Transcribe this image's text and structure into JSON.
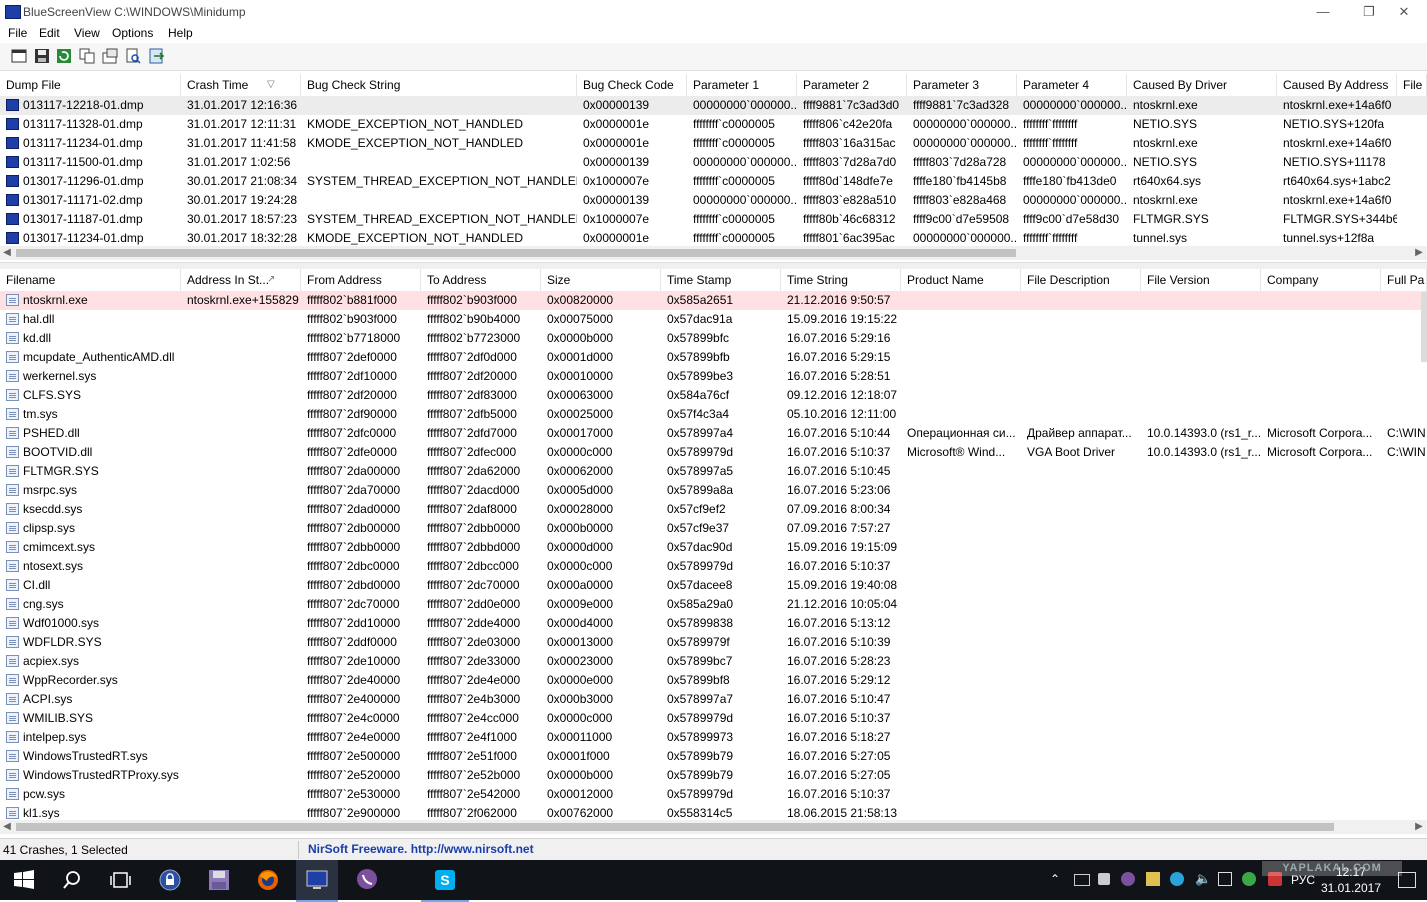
{
  "window": {
    "title": "BlueScreenView    C:\\WINDOWS\\Minidump"
  },
  "menu": [
    "File",
    "Edit",
    "View",
    "Options",
    "Help"
  ],
  "toolbar_icons": [
    "properties-icon",
    "save-icon",
    "refresh-icon",
    "copy-icon",
    "options-icon",
    "find-icon",
    "exit-icon"
  ],
  "top_table": {
    "columns": [
      "Dump File",
      "Crash Time",
      "Bug Check String",
      "Bug Check Code",
      "Parameter 1",
      "Parameter 2",
      "Parameter 3",
      "Parameter 4",
      "Caused By Driver",
      "Caused By Address",
      "File"
    ],
    "sort_indicator": "▽",
    "rows": [
      [
        "013117-12218-01.dmp",
        "31.01.2017 12:16:36",
        "",
        "0x00000139",
        "00000000`000000...",
        "ffff9881`7c3ad3d0",
        "ffff9881`7c3ad328",
        "00000000`000000...",
        "ntoskrnl.exe",
        "ntoskrnl.exe+14a6f0"
      ],
      [
        "013117-11328-01.dmp",
        "31.01.2017 12:11:31",
        "KMODE_EXCEPTION_NOT_HANDLED",
        "0x0000001e",
        "ffffffff`c0000005",
        "fffff806`c42e20fa",
        "00000000`000000...",
        "ffffffff`ffffffff",
        "NETIO.SYS",
        "NETIO.SYS+120fa"
      ],
      [
        "013117-11234-01.dmp",
        "31.01.2017 11:41:58",
        "KMODE_EXCEPTION_NOT_HANDLED",
        "0x0000001e",
        "ffffffff`c0000005",
        "fffff803`16a315ac",
        "00000000`000000...",
        "ffffffff`ffffffff",
        "ntoskrnl.exe",
        "ntoskrnl.exe+14a6f0"
      ],
      [
        "013117-11500-01.dmp",
        "31.01.2017 1:02:56",
        "",
        "0x00000139",
        "00000000`000000...",
        "fffff803`7d28a7d0",
        "fffff803`7d28a728",
        "00000000`000000...",
        "NETIO.SYS",
        "NETIO.SYS+11178"
      ],
      [
        "013017-11296-01.dmp",
        "30.01.2017 21:08:34",
        "SYSTEM_THREAD_EXCEPTION_NOT_HANDLED",
        "0x1000007e",
        "ffffffff`c0000005",
        "fffff80d`148dfe7e",
        "ffffe180`fb4145b8",
        "ffffe180`fb413de0",
        "rt640x64.sys",
        "rt640x64.sys+1abc2"
      ],
      [
        "013017-11171-02.dmp",
        "30.01.2017 19:24:28",
        "",
        "0x00000139",
        "00000000`000000...",
        "fffff803`e828a510",
        "fffff803`e828a468",
        "00000000`000000...",
        "ntoskrnl.exe",
        "ntoskrnl.exe+14a6f0"
      ],
      [
        "013017-11187-01.dmp",
        "30.01.2017 18:57:23",
        "SYSTEM_THREAD_EXCEPTION_NOT_HANDLED",
        "0x1000007e",
        "ffffffff`c0000005",
        "fffff80b`46c68312",
        "ffff9c00`d7e59508",
        "ffff9c00`d7e58d30",
        "FLTMGR.SYS",
        "FLTMGR.SYS+344b6"
      ],
      [
        "013017-11234-01.dmp",
        "30.01.2017 18:32:28",
        "KMODE_EXCEPTION_NOT_HANDLED",
        "0x0000001e",
        "ffffffff`c0000005",
        "fffff801`6ac395ac",
        "00000000`000000...",
        "ffffffff`ffffffff",
        "tunnel.sys",
        "tunnel.sys+12f8a"
      ]
    ]
  },
  "bottom_table": {
    "columns": [
      "Filename",
      "Address In St...",
      "From Address",
      "To Address",
      "Size",
      "Time Stamp",
      "Time String",
      "Product Name",
      "File Description",
      "File Version",
      "Company",
      "Full Pa"
    ],
    "sort_indicator": "↗",
    "rows": [
      [
        "ntoskrnl.exe",
        "ntoskrnl.exe+155829",
        "fffff802`b881f000",
        "fffff802`b903f000",
        "0x00820000",
        "0x585a2651",
        "21.12.2016 9:50:57",
        "",
        "",
        "",
        "",
        ""
      ],
      [
        "hal.dll",
        "",
        "fffff802`b903f000",
        "fffff802`b90b4000",
        "0x00075000",
        "0x57dac91a",
        "15.09.2016 19:15:22",
        "",
        "",
        "",
        "",
        ""
      ],
      [
        "kd.dll",
        "",
        "fffff802`b7718000",
        "fffff802`b7723000",
        "0x0000b000",
        "0x57899bfc",
        "16.07.2016 5:29:16",
        "",
        "",
        "",
        "",
        ""
      ],
      [
        "mcupdate_AuthenticAMD.dll",
        "",
        "fffff807`2def0000",
        "fffff807`2df0d000",
        "0x0001d000",
        "0x57899bfb",
        "16.07.2016 5:29:15",
        "",
        "",
        "",
        "",
        ""
      ],
      [
        "werkernel.sys",
        "",
        "fffff807`2df10000",
        "fffff807`2df20000",
        "0x00010000",
        "0x57899be3",
        "16.07.2016 5:28:51",
        "",
        "",
        "",
        "",
        ""
      ],
      [
        "CLFS.SYS",
        "",
        "fffff807`2df20000",
        "fffff807`2df83000",
        "0x00063000",
        "0x584a76cf",
        "09.12.2016 12:18:07",
        "",
        "",
        "",
        "",
        ""
      ],
      [
        "tm.sys",
        "",
        "fffff807`2df90000",
        "fffff807`2dfb5000",
        "0x00025000",
        "0x57f4c3a4",
        "05.10.2016 12:11:00",
        "",
        "",
        "",
        "",
        ""
      ],
      [
        "PSHED.dll",
        "",
        "fffff807`2dfc0000",
        "fffff807`2dfd7000",
        "0x00017000",
        "0x578997a4",
        "16.07.2016 5:10:44",
        "Операционная си...",
        "Драйвер аппарат...",
        "10.0.14393.0 (rs1_r...",
        "Microsoft Corpora...",
        "C:\\WIN"
      ],
      [
        "BOOTVID.dll",
        "",
        "fffff807`2dfe0000",
        "fffff807`2dfec000",
        "0x0000c000",
        "0x5789979d",
        "16.07.2016 5:10:37",
        "Microsoft® Wind...",
        "VGA Boot Driver",
        "10.0.14393.0 (rs1_r...",
        "Microsoft Corpora...",
        "C:\\WIN"
      ],
      [
        "FLTMGR.SYS",
        "",
        "fffff807`2da00000",
        "fffff807`2da62000",
        "0x00062000",
        "0x578997a5",
        "16.07.2016 5:10:45",
        "",
        "",
        "",
        "",
        ""
      ],
      [
        "msrpc.sys",
        "",
        "fffff807`2da70000",
        "fffff807`2dacd000",
        "0x0005d000",
        "0x57899a8a",
        "16.07.2016 5:23:06",
        "",
        "",
        "",
        "",
        ""
      ],
      [
        "ksecdd.sys",
        "",
        "fffff807`2dad0000",
        "fffff807`2daf8000",
        "0x00028000",
        "0x57cf9ef2",
        "07.09.2016 8:00:34",
        "",
        "",
        "",
        "",
        ""
      ],
      [
        "clipsp.sys",
        "",
        "fffff807`2db00000",
        "fffff807`2dbb0000",
        "0x000b0000",
        "0x57cf9e37",
        "07.09.2016 7:57:27",
        "",
        "",
        "",
        "",
        ""
      ],
      [
        "cmimcext.sys",
        "",
        "fffff807`2dbb0000",
        "fffff807`2dbbd000",
        "0x0000d000",
        "0x57dac90d",
        "15.09.2016 19:15:09",
        "",
        "",
        "",
        "",
        ""
      ],
      [
        "ntosext.sys",
        "",
        "fffff807`2dbc0000",
        "fffff807`2dbcc000",
        "0x0000c000",
        "0x5789979d",
        "16.07.2016 5:10:37",
        "",
        "",
        "",
        "",
        ""
      ],
      [
        "CI.dll",
        "",
        "fffff807`2dbd0000",
        "fffff807`2dc70000",
        "0x000a0000",
        "0x57dacee8",
        "15.09.2016 19:40:08",
        "",
        "",
        "",
        "",
        ""
      ],
      [
        "cng.sys",
        "",
        "fffff807`2dc70000",
        "fffff807`2dd0e000",
        "0x0009e000",
        "0x585a29a0",
        "21.12.2016 10:05:04",
        "",
        "",
        "",
        "",
        ""
      ],
      [
        "Wdf01000.sys",
        "",
        "fffff807`2dd10000",
        "fffff807`2dde4000",
        "0x000d4000",
        "0x57899838",
        "16.07.2016 5:13:12",
        "",
        "",
        "",
        "",
        ""
      ],
      [
        "WDFLDR.SYS",
        "",
        "fffff807`2ddf0000",
        "fffff807`2de03000",
        "0x00013000",
        "0x5789979f",
        "16.07.2016 5:10:39",
        "",
        "",
        "",
        "",
        ""
      ],
      [
        "acpiex.sys",
        "",
        "fffff807`2de10000",
        "fffff807`2de33000",
        "0x00023000",
        "0x57899bc7",
        "16.07.2016 5:28:23",
        "",
        "",
        "",
        "",
        ""
      ],
      [
        "WppRecorder.sys",
        "",
        "fffff807`2de40000",
        "fffff807`2de4e000",
        "0x0000e000",
        "0x57899bf8",
        "16.07.2016 5:29:12",
        "",
        "",
        "",
        "",
        ""
      ],
      [
        "ACPI.sys",
        "",
        "fffff807`2e400000",
        "fffff807`2e4b3000",
        "0x000b3000",
        "0x578997a7",
        "16.07.2016 5:10:47",
        "",
        "",
        "",
        "",
        ""
      ],
      [
        "WMILIB.SYS",
        "",
        "fffff807`2e4c0000",
        "fffff807`2e4cc000",
        "0x0000c000",
        "0x5789979d",
        "16.07.2016 5:10:37",
        "",
        "",
        "",
        "",
        ""
      ],
      [
        "intelpep.sys",
        "",
        "fffff807`2e4e0000",
        "fffff807`2e4f1000",
        "0x00011000",
        "0x57899973",
        "16.07.2016 5:18:27",
        "",
        "",
        "",
        "",
        ""
      ],
      [
        "WindowsTrustedRT.sys",
        "",
        "fffff807`2e500000",
        "fffff807`2e51f000",
        "0x0001f000",
        "0x57899b79",
        "16.07.2016 5:27:05",
        "",
        "",
        "",
        "",
        ""
      ],
      [
        "WindowsTrustedRTProxy.sys",
        "",
        "fffff807`2e520000",
        "fffff807`2e52b000",
        "0x0000b000",
        "0x57899b79",
        "16.07.2016 5:27:05",
        "",
        "",
        "",
        "",
        ""
      ],
      [
        "pcw.sys",
        "",
        "fffff807`2e530000",
        "fffff807`2e542000",
        "0x00012000",
        "0x5789979d",
        "16.07.2016 5:10:37",
        "",
        "",
        "",
        "",
        ""
      ],
      [
        "kl1.sys",
        "",
        "fffff807`2e900000",
        "fffff807`2f062000",
        "0x00762000",
        "0x558314c5",
        "18.06.2015 21:58:13",
        "",
        "",
        "",
        "",
        ""
      ]
    ]
  },
  "status": {
    "left": "41 Crashes, 1 Selected",
    "right": "NirSoft Freeware.  http://www.nirsoft.net"
  },
  "taskbar": {
    "icons": [
      "start-icon",
      "search-icon",
      "task-view-icon",
      "password-manager-icon",
      "floppy-icon",
      "firefox-icon",
      "bluescreenview-icon",
      "viber-icon",
      "skype-icon"
    ],
    "lang": "РУС",
    "time": "12:17",
    "date": "31.01.2017"
  },
  "watermark": "YAPLAKAL.COM"
}
